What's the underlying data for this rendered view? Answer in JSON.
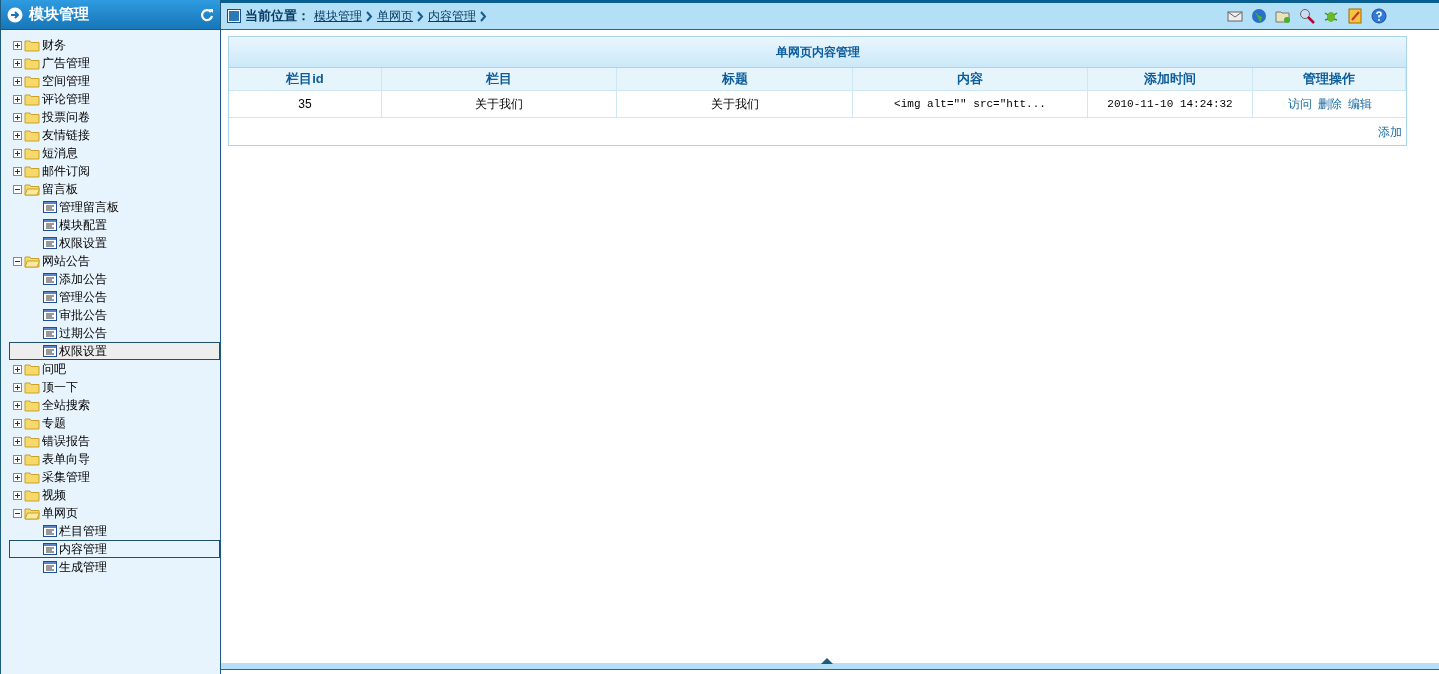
{
  "sidebar": {
    "title": "模块管理",
    "tree": [
      {
        "label": "财务",
        "expanded": false
      },
      {
        "label": "广告管理",
        "expanded": false
      },
      {
        "label": "空间管理",
        "expanded": false
      },
      {
        "label": "评论管理",
        "expanded": false
      },
      {
        "label": "投票问卷",
        "expanded": false
      },
      {
        "label": "友情链接",
        "expanded": false
      },
      {
        "label": "短消息",
        "expanded": false
      },
      {
        "label": "邮件订阅",
        "expanded": false
      },
      {
        "label": "留言板",
        "expanded": true,
        "children": [
          {
            "label": "管理留言板",
            "selected": false,
            "hovered": false
          },
          {
            "label": "模块配置",
            "selected": false,
            "hovered": false
          },
          {
            "label": "权限设置",
            "selected": false,
            "hovered": false
          }
        ]
      },
      {
        "label": "网站公告",
        "expanded": true,
        "children": [
          {
            "label": "添加公告",
            "selected": false,
            "hovered": false
          },
          {
            "label": "管理公告",
            "selected": false,
            "hovered": false
          },
          {
            "label": "审批公告",
            "selected": false,
            "hovered": false
          },
          {
            "label": "过期公告",
            "selected": false,
            "hovered": false
          },
          {
            "label": "权限设置",
            "selected": false,
            "hovered": true
          }
        ]
      },
      {
        "label": "问吧",
        "expanded": false
      },
      {
        "label": "顶一下",
        "expanded": false
      },
      {
        "label": "全站搜索",
        "expanded": false
      },
      {
        "label": "专题",
        "expanded": false
      },
      {
        "label": "错误报告",
        "expanded": false
      },
      {
        "label": "表单向导",
        "expanded": false
      },
      {
        "label": "采集管理",
        "expanded": false
      },
      {
        "label": "视频",
        "expanded": false
      },
      {
        "label": "单网页",
        "expanded": true,
        "children": [
          {
            "label": "栏目管理",
            "selected": false,
            "hovered": false
          },
          {
            "label": "内容管理",
            "selected": true,
            "hovered": false
          },
          {
            "label": "生成管理",
            "selected": false,
            "hovered": false
          }
        ]
      }
    ]
  },
  "breadcrumb": {
    "label": "当前位置：",
    "links": [
      "模块管理",
      "单网页",
      "内容管理"
    ]
  },
  "table": {
    "title": "单网页内容管理",
    "columns": [
      "栏目id",
      "栏目",
      "标题",
      "内容",
      "添加时间",
      "管理操作"
    ],
    "rows": [
      {
        "cells": [
          "35",
          "关于我们",
          "关于我们",
          "<img alt=\"\" src=\"htt...",
          "2010-11-10 14:24:32"
        ],
        "actions": [
          "访问",
          "删除",
          "编辑"
        ]
      }
    ],
    "add_link": "添加"
  }
}
